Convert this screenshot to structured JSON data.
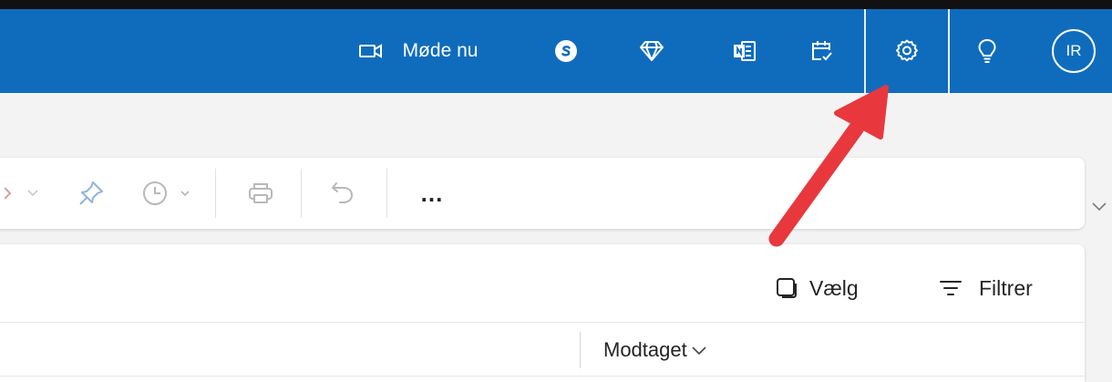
{
  "topbar": {
    "meet_now_label": "Møde nu",
    "avatar_initials": "IR",
    "icons": [
      "video-camera-icon",
      "skype-icon",
      "diamond-icon",
      "onenote-icon",
      "calendar-check-icon",
      "gear-icon",
      "lightbulb-icon"
    ],
    "background": "#0f6cbd"
  },
  "toolbar": {
    "icons": [
      "flag-icon",
      "pin-icon",
      "clock-icon",
      "print-icon",
      "undo-icon"
    ],
    "more_label": "..."
  },
  "message_list": {
    "select_label": "Vælg",
    "filter_label": "Filtrer",
    "column_received": "Modtaget"
  },
  "annotation": {
    "arrow_color": "#e8383d"
  }
}
